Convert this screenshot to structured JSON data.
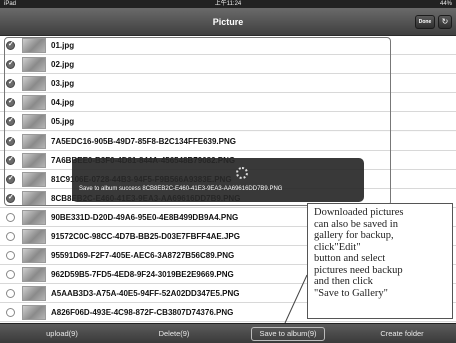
{
  "status_bar": {
    "device": "iPad",
    "time": "上午11:24",
    "battery": "44%"
  },
  "nav": {
    "title": "Picture",
    "done_label": "Done",
    "refresh_icon": "refresh-icon"
  },
  "files": [
    {
      "name": "01.jpg",
      "selected": true
    },
    {
      "name": "02.jpg",
      "selected": true
    },
    {
      "name": "03.jpg",
      "selected": true
    },
    {
      "name": "04.jpg",
      "selected": true
    },
    {
      "name": "05.jpg",
      "selected": true
    },
    {
      "name": "7A5EDC16-905B-49D7-85F8-B2C134FFE639.PNG",
      "selected": true
    },
    {
      "name": "7A6BBEE0-B3F0-4D81-844A-456548B79082.PNG",
      "selected": true
    },
    {
      "name": "81C9106E-0728-44B3-94F5-F9B566A9383E.PNG",
      "selected": true
    },
    {
      "name": "8CB8EB2C-E460-41E3-9EA3-AA69616DD7B9.PNG",
      "selected": true
    },
    {
      "name": "90BE331D-D20D-49A6-95E0-4E8B499DB9A4.PNG",
      "selected": false
    },
    {
      "name": "91572C0C-98CC-4D7B-BB25-D03E7FBFF4AE.JPG",
      "selected": false
    },
    {
      "name": "95591D69-F2F7-405E-AEC6-3A8727B56C89.PNG",
      "selected": false
    },
    {
      "name": "962D59B5-7FD5-4ED8-9F24-3019BE2E9669.PNG",
      "selected": false
    },
    {
      "name": "A5AAB3D3-A75A-40E5-94FF-52A02DD347E5.PNG",
      "selected": false
    },
    {
      "name": "A826F06D-493E-4C98-872F-CB3807D74376.PNG",
      "selected": false
    }
  ],
  "toast": {
    "message": "Save to album success 8CB8EB2C-E460-41E3-9EA3-AA69616DD7B9.PNG"
  },
  "callout": {
    "lines": [
      "Downloaded pictures",
      "can also be saved in",
      "gallery for backup,",
      "click\"Edit\"",
      "button and select",
      "pictures need backup",
      "and then click",
      "\"Save to Gallery\""
    ]
  },
  "toolbar": {
    "upload_label": "upload(9)",
    "delete_label": "Delete(9)",
    "save_label": "Save to album(9)",
    "create_label": "Create folder"
  }
}
